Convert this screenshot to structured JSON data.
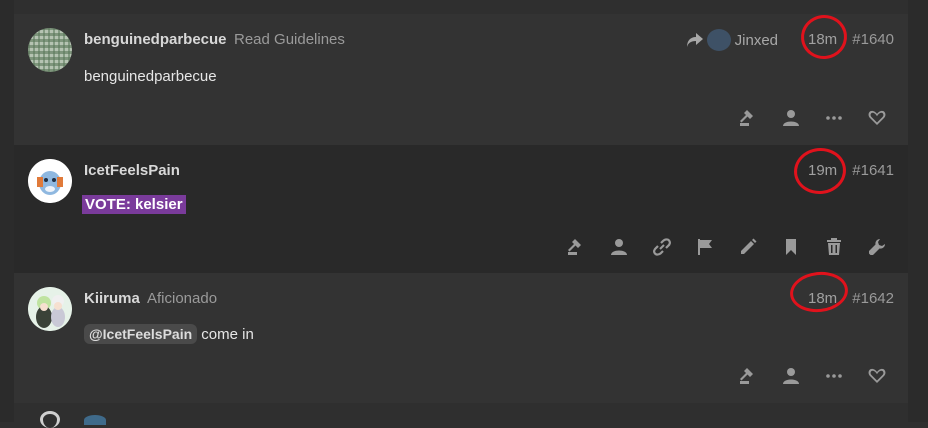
{
  "posts": [
    {
      "username": "benguinedparbecue",
      "user_title": "Read Guidelines",
      "reply_to": "Jinxed",
      "time": "18m",
      "post_number": "#1640",
      "body": "benguinedparbecue"
    },
    {
      "username": "IcetFeelsPain",
      "user_title": "",
      "time": "19m",
      "post_number": "#1641",
      "vote_text": "VOTE: kelsier"
    },
    {
      "username": "Kiiruma",
      "user_title": "Aficionado",
      "time": "18m",
      "post_number": "#1642",
      "mention": "@IcetFeelsPain",
      "body_after_mention": " come in"
    }
  ],
  "colors": {
    "annotation_circle": "#e0121c",
    "vote_highlight": "#7a3b9b"
  },
  "icons": {
    "post1_actions": [
      "hammer-icon",
      "user-icon",
      "more-icon",
      "heart-icon"
    ],
    "post2_actions": [
      "hammer-icon",
      "user-icon",
      "link-icon",
      "flag-icon",
      "pencil-icon",
      "bookmark-icon",
      "trash-icon",
      "wrench-icon"
    ],
    "post3_actions": [
      "hammer-icon",
      "user-icon",
      "more-icon",
      "heart-icon"
    ]
  }
}
